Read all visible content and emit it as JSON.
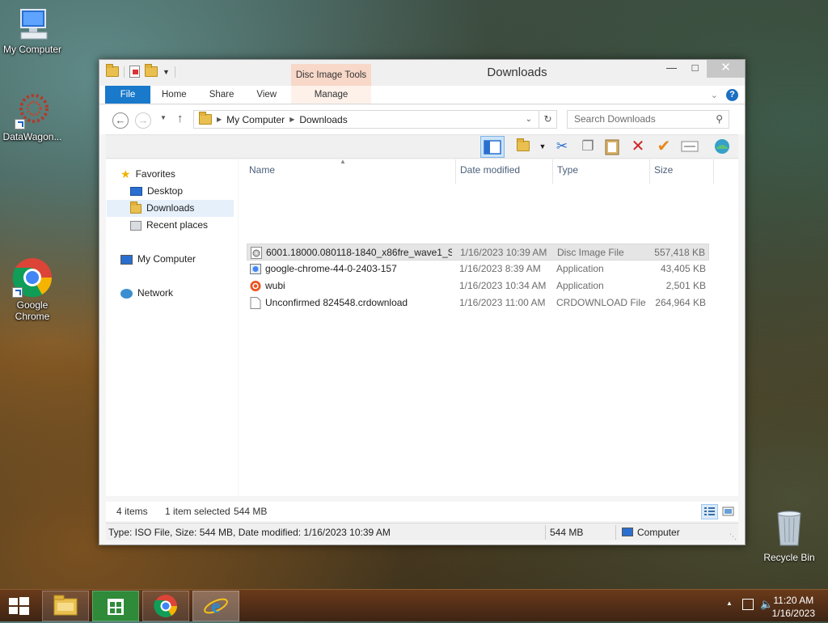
{
  "desktop": {
    "icons": [
      {
        "label": "My Computer"
      },
      {
        "label": "DataWagon..."
      },
      {
        "label_line1": "Google",
        "label_line2": "Chrome"
      }
    ],
    "recycle_bin": "Recycle Bin"
  },
  "window": {
    "title": "Downloads",
    "context_tab_group": "Disc Image Tools",
    "tabs": [
      "File",
      "Home",
      "Share",
      "View",
      "Manage"
    ],
    "address": {
      "root": "My Computer",
      "current": "Downloads"
    },
    "search_placeholder": "Search Downloads"
  },
  "nav_pane": {
    "favorites": "Favorites",
    "items": [
      "Desktop",
      "Downloads",
      "Recent places"
    ],
    "computer": "My Computer",
    "network": "Network"
  },
  "columns": [
    "Name",
    "Date modified",
    "Type",
    "Size"
  ],
  "files": [
    {
      "name": "6001.18000.080118-1840_x86fre_wave1_Se...",
      "date": "1/16/2023 10:39 AM",
      "type": "Disc Image File",
      "size": "557,418 KB",
      "selected": true
    },
    {
      "name": "google-chrome-44-0-2403-157",
      "date": "1/16/2023 8:39 AM",
      "type": "Application",
      "size": "43,405 KB"
    },
    {
      "name": "wubi",
      "date": "1/16/2023 10:34 AM",
      "type": "Application",
      "size": "2,501 KB"
    },
    {
      "name": "Unconfirmed 824548.crdownload",
      "date": "1/16/2023 11:00 AM",
      "type": "CRDOWNLOAD File",
      "size": "264,964 KB"
    }
  ],
  "status": {
    "items": "4 items",
    "selected": "1 item selected",
    "selected_size": "544 MB",
    "details": "Type: ISO File, Size: 544 MB, Date modified: 1/16/2023 10:39 AM",
    "size": "544 MB",
    "location": "Computer"
  },
  "taskbar": {
    "time": "11:20 AM",
    "date": "1/16/2023"
  },
  "colors": {
    "file_tab": "#1979ca",
    "context_tab": "#f8d8c8",
    "selection": "#e5f0fb"
  }
}
